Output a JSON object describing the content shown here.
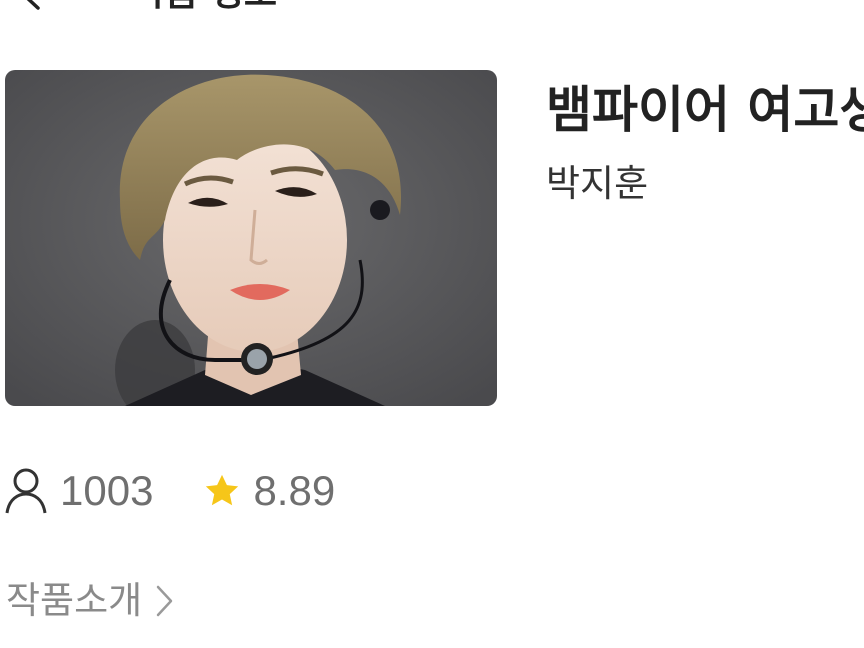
{
  "header": {
    "title": "작품 정보",
    "back_icon": "chevron-left-icon"
  },
  "work": {
    "title": "뱀파이어 여고생",
    "author": "박지훈",
    "cover_alt": "cover-photo"
  },
  "stats": {
    "readers": "1003",
    "rating": "8.89",
    "readers_icon": "user-icon",
    "rating_icon": "star-icon",
    "star_color": "#f6c619"
  },
  "intro": {
    "label": "작품소개",
    "chevron_icon": "chevron-right-icon"
  }
}
